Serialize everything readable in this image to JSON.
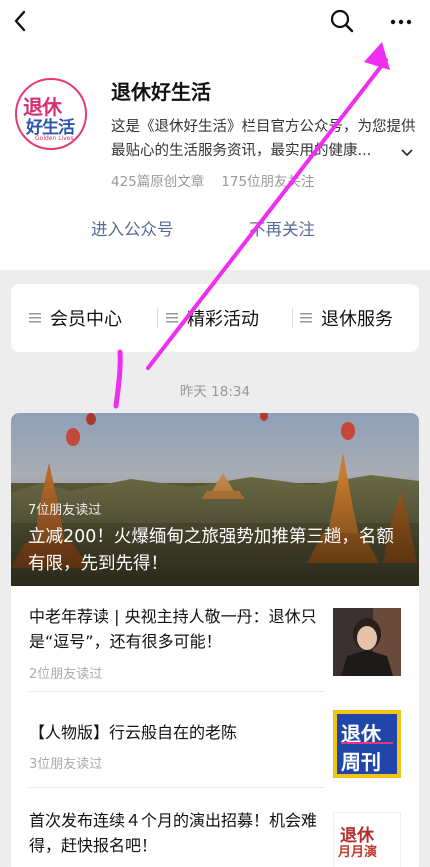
{
  "account": {
    "name": "退休好生活",
    "avatar_text_1": "退休",
    "avatar_text_2": "好生活",
    "avatar_text_3": "Golden Lives",
    "intro": "这是《退休好生活》栏目官方公众号，为您提供最贴心的生活服务资讯，最实用的健康...",
    "articles": "425篇原创文章",
    "followers": "175位朋友关注",
    "enter_label": "进入公众号",
    "unfollow_label": "不再关注"
  },
  "menu": {
    "items": [
      {
        "label": "会员中心"
      },
      {
        "label": "精彩活动"
      },
      {
        "label": "退休服务"
      }
    ]
  },
  "feed": {
    "time": "昨天 18:34",
    "hero": {
      "readers": "7位朋友读过",
      "title": "立减200！火爆缅甸之旅强势加推第三趟，名额有限，先到先得！"
    },
    "items": [
      {
        "title": "中老年荐读 | 央视主持人敬一丹：退休只是“逗号”，还有很多可能！",
        "readers": "2位朋友读过"
      },
      {
        "title": "【人物版】行云般自在的老陈",
        "readers": "3位朋友读过",
        "thumb_text_1": "退休",
        "thumb_text_2": "周刊"
      },
      {
        "title": "首次发布连续４个月的演出招募！机会难得，赶快报名吧！",
        "thumb_text_1": "退休",
        "thumb_text_2": "月月演"
      }
    ]
  },
  "colors": {
    "link": "#576b95",
    "annotation": "#ee2ef0",
    "background": "#ededed"
  },
  "icons": [
    "back-icon",
    "search-icon",
    "more-icon",
    "chevron-down-icon",
    "menu-list-icon"
  ]
}
